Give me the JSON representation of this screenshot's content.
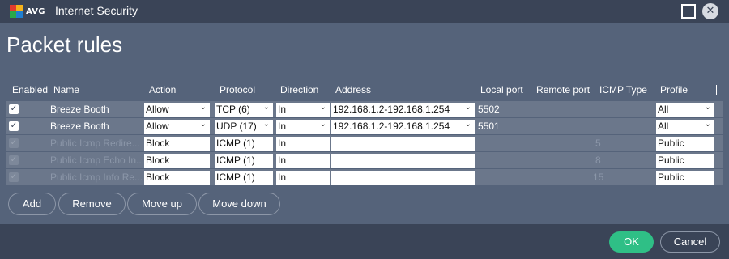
{
  "window": {
    "brand": "AVG",
    "title": "Internet Security",
    "close_glyph": "✕"
  },
  "page": {
    "heading": "Packet rules"
  },
  "table": {
    "columns": [
      "Enabled",
      "Name",
      "Action",
      "Protocol",
      "Direction",
      "Address",
      "Local port",
      "Remote port",
      "ICMP Type",
      "Profile"
    ],
    "rows": [
      {
        "enabled": true,
        "disabled": false,
        "name": "Breeze Booth",
        "action": "Allow",
        "protocol": "TCP (6)",
        "direction": "In",
        "address": "192.168.1.2-192.168.1.254",
        "local_port": "5502",
        "remote_port": "",
        "icmp_type": "",
        "profile": "All"
      },
      {
        "enabled": true,
        "disabled": false,
        "name": "Breeze Booth",
        "action": "Allow",
        "protocol": "UDP (17)",
        "direction": "In",
        "address": "192.168.1.2-192.168.1.254",
        "local_port": "5501",
        "remote_port": "",
        "icmp_type": "",
        "profile": "All"
      },
      {
        "enabled": true,
        "disabled": true,
        "name": "Public Icmp Redire...",
        "action": "Block",
        "protocol": "ICMP (1)",
        "direction": "In",
        "address": "",
        "local_port": "",
        "remote_port": "",
        "icmp_type": "5",
        "profile": "Public"
      },
      {
        "enabled": true,
        "disabled": true,
        "name": "Public Icmp Echo In...",
        "action": "Block",
        "protocol": "ICMP (1)",
        "direction": "In",
        "address": "",
        "local_port": "",
        "remote_port": "",
        "icmp_type": "8",
        "profile": "Public"
      },
      {
        "enabled": true,
        "disabled": true,
        "name": "Public Icmp Info Re...",
        "action": "Block",
        "protocol": "ICMP (1)",
        "direction": "In",
        "address": "",
        "local_port": "",
        "remote_port": "",
        "icmp_type": "15",
        "profile": "Public"
      }
    ]
  },
  "actions": {
    "add": "Add",
    "remove": "Remove",
    "move_up": "Move up",
    "move_down": "Move down"
  },
  "footer": {
    "ok": "OK",
    "cancel": "Cancel"
  },
  "colors": {
    "background": "#55637a",
    "titlebar": "#3a4457",
    "ok_green": "#2fbf86",
    "logo": [
      "#e23b2e",
      "#f6b21b",
      "#2aa84a",
      "#1f7fd1"
    ]
  },
  "icons": {
    "checkbox": "checkmark-icon",
    "dropdown": "chevron-down-icon",
    "maximize": "maximize-icon",
    "close": "close-icon",
    "logo": "avg-logo-icon"
  }
}
